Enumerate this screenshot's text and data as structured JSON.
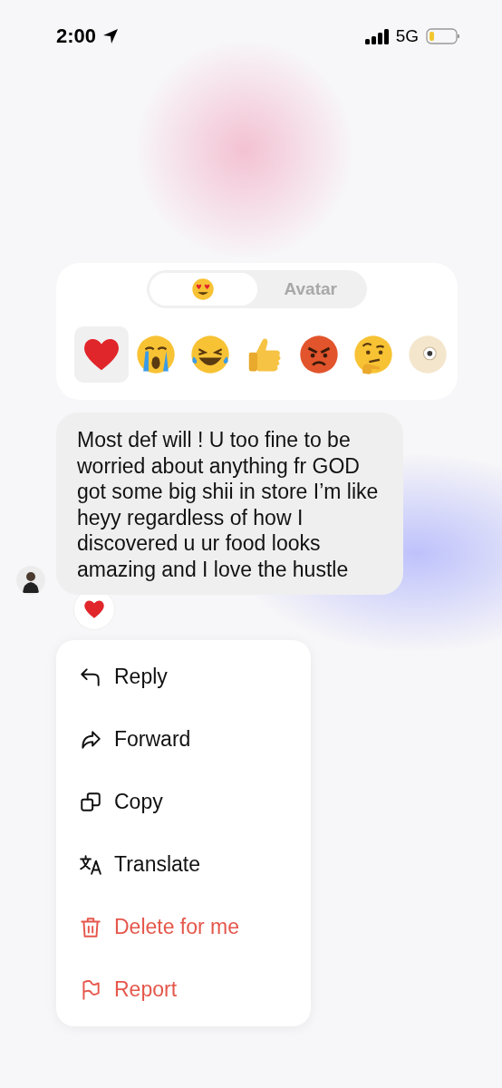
{
  "status_bar": {
    "time": "2:00",
    "network": "5G"
  },
  "reaction_picker": {
    "tabs": [
      {
        "kind": "emoji",
        "selected": true
      },
      {
        "kind": "text",
        "label": "Avatar",
        "selected": false
      }
    ],
    "reactions": [
      {
        "kind": "heart",
        "selected": true
      },
      {
        "kind": "crying",
        "selected": false
      },
      {
        "kind": "laughing",
        "selected": false
      },
      {
        "kind": "thumbs-up",
        "selected": false
      },
      {
        "kind": "angry",
        "selected": false
      },
      {
        "kind": "thinking",
        "selected": false
      },
      {
        "kind": "shocked",
        "selected": false
      }
    ]
  },
  "message": {
    "text": "Most def will ! U too fine to be worried about anything fr GOD got some big shii in store I’m like heyy regardless of how I discovered u ur food looks amazing and I love the hustle",
    "reaction": {
      "kind": "heart"
    }
  },
  "menu": [
    {
      "kind": "reply",
      "label": "Reply",
      "destructive": false
    },
    {
      "kind": "forward",
      "label": "Forward",
      "destructive": false
    },
    {
      "kind": "copy",
      "label": "Copy",
      "destructive": false
    },
    {
      "kind": "translate",
      "label": "Translate",
      "destructive": false
    },
    {
      "kind": "delete",
      "label": "Delete for me",
      "destructive": true
    },
    {
      "kind": "report",
      "label": "Report",
      "destructive": true
    }
  ]
}
